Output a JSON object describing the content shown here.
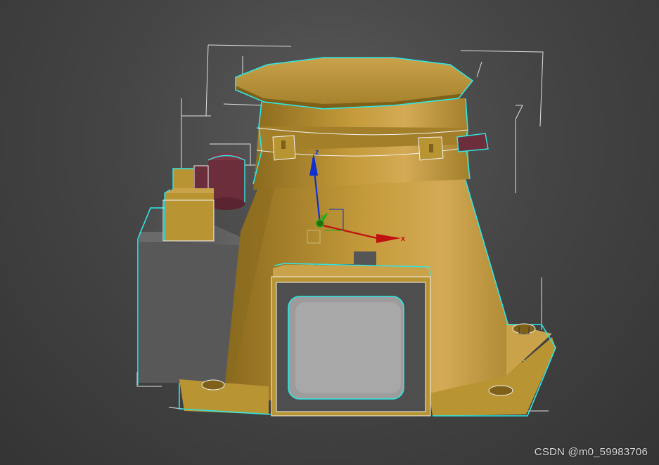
{
  "viewport": {
    "background": "#454545",
    "selection_outline_color": "#2ee8e8",
    "bounding_box_color": "#f2f2f2"
  },
  "model": {
    "body_color": "#b89433",
    "body_shadow_color": "#8a6a1e",
    "cap_color": "#a37f2a",
    "knob_color": "#6b2e3a",
    "gray_block_color": "#5a5a5a",
    "screen_color": "#9a9a9a"
  },
  "gizmo": {
    "x_label": "x",
    "y_label": "y",
    "z_label": "z",
    "x_color": "#c01010",
    "y_color": "#10b010",
    "z_color": "#1030d0"
  },
  "watermark": {
    "text": "CSDN @m0_59983706"
  }
}
